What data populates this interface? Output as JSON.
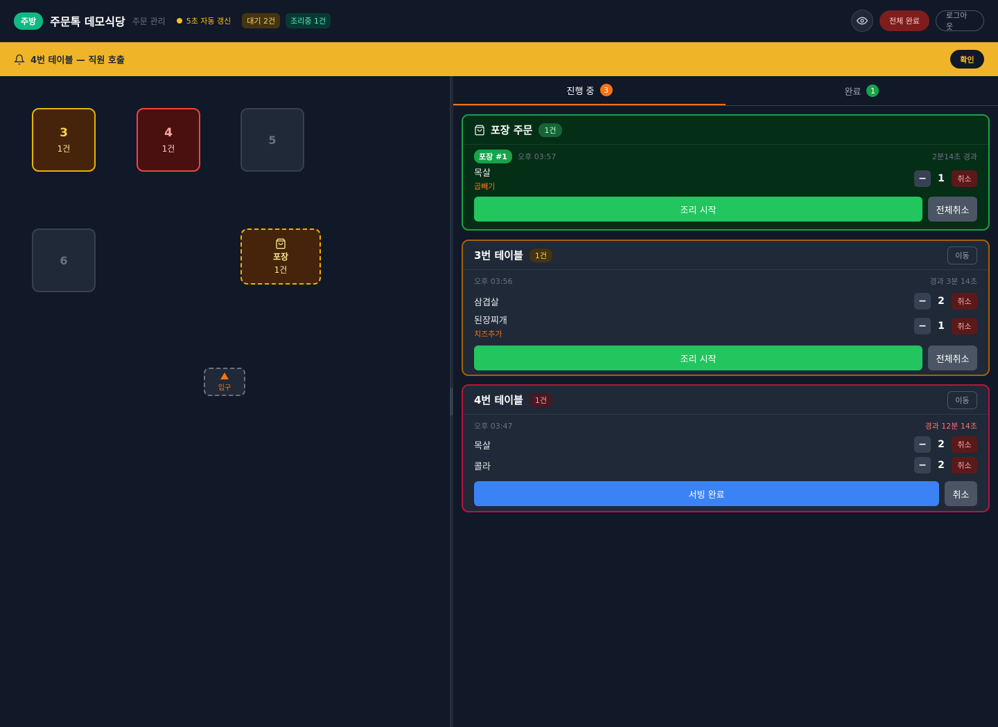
{
  "header": {
    "role_badge": "주방",
    "store_name": "주문톡 데모식당",
    "subtitle": "주문 관리",
    "refresh_text": "5초 자동 갱신",
    "waiting_count": "대기 2건",
    "cooking_count": "조리중 1건",
    "all_done_label": "전체 완료",
    "logout_label": "로그아웃"
  },
  "alert": {
    "text": "4번 테이블 — 직원 호출",
    "confirm_label": "확인"
  },
  "floor": {
    "tables": [
      {
        "num": "3",
        "count": "1건"
      },
      {
        "num": "4",
        "count": "1건"
      },
      {
        "num": "5"
      },
      {
        "num": "6"
      }
    ],
    "takeout": {
      "label": "포장",
      "count": "1건"
    },
    "entrance_label": "입구"
  },
  "tabs": [
    {
      "label": "진행 중",
      "badge": "3"
    },
    {
      "label": "완료",
      "badge": "1"
    }
  ],
  "orders": [
    {
      "title": "포장 주문",
      "count": "1건",
      "tag": "포장 #1",
      "time": "오후 03:57",
      "elapsed": "2분14초  경과",
      "items": [
        {
          "name": "목살",
          "option": "곱빼기",
          "qty": "1",
          "cancel": "취소"
        }
      ],
      "primary_label": "조리 시작",
      "secondary_label": "전체취소"
    },
    {
      "title": "3번 테이블",
      "count": "1건",
      "move_label": "이동",
      "time": "오후 03:56",
      "elapsed": "경과  3분  14초",
      "items": [
        {
          "name": "삼겹살",
          "qty": "2",
          "cancel": "취소"
        },
        {
          "name": "된장찌개",
          "option": "치즈추가",
          "qty": "1",
          "cancel": "취소"
        }
      ],
      "primary_label": "조리 시작",
      "secondary_label": "전체취소"
    },
    {
      "title": "4번 테이블",
      "count": "1건",
      "move_label": "이동",
      "time": "오후 03:47",
      "elapsed": "경과  12분  14초",
      "items": [
        {
          "name": "목살",
          "qty": "2",
          "cancel": "취소"
        },
        {
          "name": "콜라",
          "qty": "2",
          "cancel": "취소"
        }
      ],
      "primary_label": "서빙 완료",
      "secondary_label": "취소"
    }
  ],
  "colors": {
    "bg": "#111827",
    "alert": "#f0b429",
    "accent_orange": "#f97316",
    "green": "#22c55e",
    "blue": "#3b82f6",
    "danger": "#ef4444"
  }
}
